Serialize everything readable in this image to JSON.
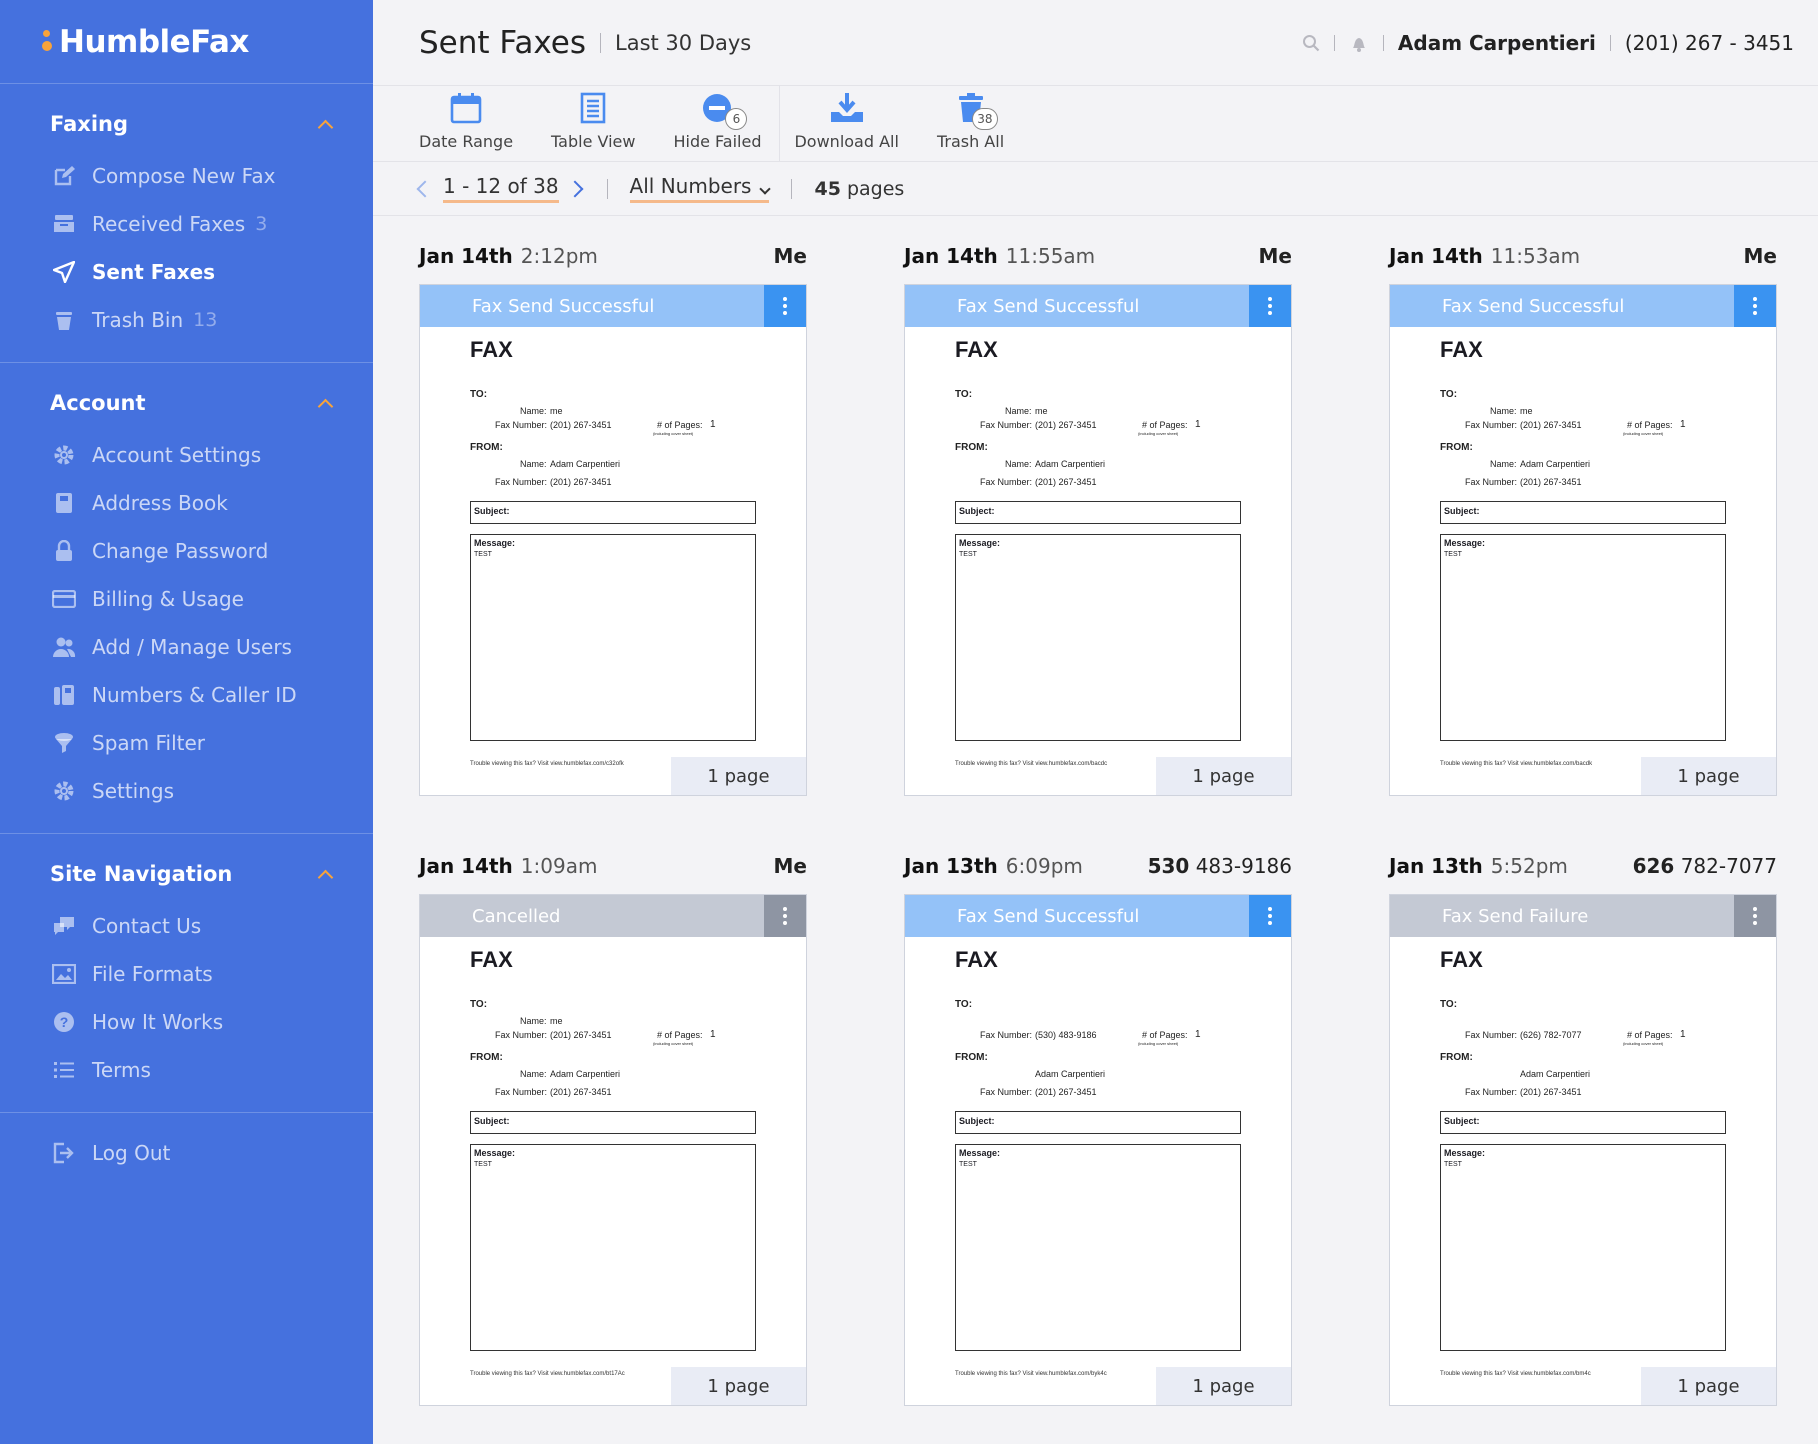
{
  "app": {
    "name": "HumbleFax"
  },
  "sidebar": {
    "sections": [
      {
        "title": "Faxing",
        "items": [
          {
            "label": "Compose New Fax",
            "icon": "compose-icon",
            "count": ""
          },
          {
            "label": "Received Faxes",
            "icon": "inbox-icon",
            "count": "3"
          },
          {
            "label": "Sent Faxes",
            "icon": "send-icon",
            "count": "",
            "active": true
          },
          {
            "label": "Trash Bin",
            "icon": "trash-icon",
            "count": "13"
          }
        ]
      },
      {
        "title": "Account",
        "items": [
          {
            "label": "Account Settings",
            "icon": "gear-icon"
          },
          {
            "label": "Address Book",
            "icon": "book-icon"
          },
          {
            "label": "Change Password",
            "icon": "lock-icon"
          },
          {
            "label": "Billing & Usage",
            "icon": "credit-card-icon"
          },
          {
            "label": "Add / Manage Users",
            "icon": "users-icon"
          },
          {
            "label": "Numbers & Caller ID",
            "icon": "fax-machine-icon"
          },
          {
            "label": "Spam Filter",
            "icon": "filter-icon"
          },
          {
            "label": "Settings",
            "icon": "gear-icon"
          }
        ]
      },
      {
        "title": "Site Navigation",
        "items": [
          {
            "label": "Contact Us",
            "icon": "chat-icon"
          },
          {
            "label": "File Formats",
            "icon": "image-icon"
          },
          {
            "label": "How It Works",
            "icon": "question-icon"
          },
          {
            "label": "Terms",
            "icon": "list-icon"
          }
        ]
      }
    ],
    "logout": {
      "label": "Log Out",
      "icon": "logout-icon"
    }
  },
  "header": {
    "title": "Sent Faxes",
    "subtitle": "Last 30 Days",
    "user_name": "Adam Carpentieri",
    "user_phone": "(201) 267 - 3451"
  },
  "toolbar": {
    "date_range": "Date Range",
    "table_view": "Table View",
    "hide_failed": "Hide Failed",
    "hide_failed_count": "6",
    "download_all": "Download All",
    "trash_all": "Trash All",
    "trash_all_count": "38"
  },
  "pagination": {
    "range": "1 - 12 of 38",
    "filter": "All Numbers",
    "pages_count": "45",
    "pages_word": "pages"
  },
  "colors": {
    "sidebar_bg": "#4571de",
    "accent_orange": "#f9a33a",
    "status_success": "#94c2f8",
    "status_gray": "#c4c9d4",
    "kebab_blue": "#3a93f1"
  },
  "cards": [
    {
      "date": "Jan 14th",
      "time": "2:12pm",
      "recipient_bold": "Me",
      "recipient_rest": "",
      "status": "Fax Send Successful",
      "status_kind": "success",
      "doc": {
        "title": "FAX",
        "to": "TO:",
        "name_label": "Name:",
        "to_name": "me",
        "fax_label": "Fax Number:",
        "to_fax": "(201) 267-3451",
        "pages_label": "# of Pages:",
        "pages_num": "1",
        "pages_note": "(including cover sheet)",
        "from": "FROM:",
        "from_name": "Adam Carpentieri",
        "from_fax": "(201) 267-3451",
        "subject": "Subject:",
        "message": "Message:",
        "message_text": "TEST",
        "footer": "Trouble viewing this fax? Visit view.humblefax.com/c32ofk"
      },
      "pages": "1 page"
    },
    {
      "date": "Jan 14th",
      "time": "11:55am",
      "recipient_bold": "Me",
      "recipient_rest": "",
      "status": "Fax Send Successful",
      "status_kind": "success",
      "doc": {
        "title": "FAX",
        "to": "TO:",
        "name_label": "Name:",
        "to_name": "me",
        "fax_label": "Fax Number:",
        "to_fax": "(201) 267-3451",
        "pages_label": "# of Pages:",
        "pages_num": "1",
        "pages_note": "(including cover sheet)",
        "from": "FROM:",
        "from_name": "Adam Carpentieri",
        "from_fax": "(201) 267-3451",
        "subject": "Subject:",
        "message": "Message:",
        "message_text": "TEST",
        "footer": "Trouble viewing this fax? Visit view.humblefax.com/bacdc"
      },
      "pages": "1 page"
    },
    {
      "date": "Jan 14th",
      "time": "11:53am",
      "recipient_bold": "Me",
      "recipient_rest": "",
      "status": "Fax Send Successful",
      "status_kind": "success",
      "doc": {
        "title": "FAX",
        "to": "TO:",
        "name_label": "Name:",
        "to_name": "me",
        "fax_label": "Fax Number:",
        "to_fax": "(201) 267-3451",
        "pages_label": "# of Pages:",
        "pages_num": "1",
        "pages_note": "(including cover sheet)",
        "from": "FROM:",
        "from_name": "Adam Carpentieri",
        "from_fax": "(201) 267-3451",
        "subject": "Subject:",
        "message": "Message:",
        "message_text": "TEST",
        "footer": "Trouble viewing this fax? Visit view.humblefax.com/bacdk"
      },
      "pages": "1 page"
    },
    {
      "date": "Jan 14th",
      "time": "1:09am",
      "recipient_bold": "Me",
      "recipient_rest": "",
      "status": "Cancelled",
      "status_kind": "gray",
      "doc": {
        "title": "FAX",
        "to": "TO:",
        "name_label": "Name:",
        "to_name": "me",
        "fax_label": "Fax Number:",
        "to_fax": "(201) 267-3451",
        "pages_label": "# of Pages:",
        "pages_num": "1",
        "pages_note": "(including cover sheet)",
        "from": "FROM:",
        "from_name": "Adam Carpentieri",
        "from_fax": "(201) 267-3451",
        "subject": "Subject:",
        "message": "Message:",
        "message_text": "TEST",
        "footer": "Trouble viewing this fax? Visit view.humblefax.com/bt17Ac"
      },
      "pages": "1 page"
    },
    {
      "date": "Jan 13th",
      "time": "6:09pm",
      "recipient_bold": "530",
      "recipient_rest": " 483-9186",
      "status": "Fax Send Successful",
      "status_kind": "success",
      "doc": {
        "title": "FAX",
        "to": "TO:",
        "name_label": "",
        "to_name": "",
        "fax_label": "Fax Number:",
        "to_fax": "(530) 483-9186",
        "pages_label": "# of Pages:",
        "pages_num": "1",
        "pages_note": "(including cover sheet)",
        "from": "FROM:",
        "from_name": "Adam Carpentieri",
        "from_fax": "(201) 267-3451",
        "subject": "Subject:",
        "message": "Message:",
        "message_text": "TEST",
        "footer": "Trouble viewing this fax? Visit view.humblefax.com/byk4c"
      },
      "pages": "1 page"
    },
    {
      "date": "Jan 13th",
      "time": "5:52pm",
      "recipient_bold": "626",
      "recipient_rest": " 782-7077",
      "status": "Fax Send Failure",
      "status_kind": "gray",
      "doc": {
        "title": "FAX",
        "to": "TO:",
        "name_label": "",
        "to_name": "",
        "fax_label": "Fax Number:",
        "to_fax": "(626) 782-7077",
        "pages_label": "# of Pages:",
        "pages_num": "1",
        "pages_note": "(including cover sheet)",
        "from": "FROM:",
        "from_name": "Adam Carpentieri",
        "from_fax": "(201) 267-3451",
        "subject": "Subject:",
        "message": "Message:",
        "message_text": "TEST",
        "footer": "Trouble viewing this fax? Visit view.humblefax.com/bm4c"
      },
      "pages": "1 page"
    }
  ]
}
